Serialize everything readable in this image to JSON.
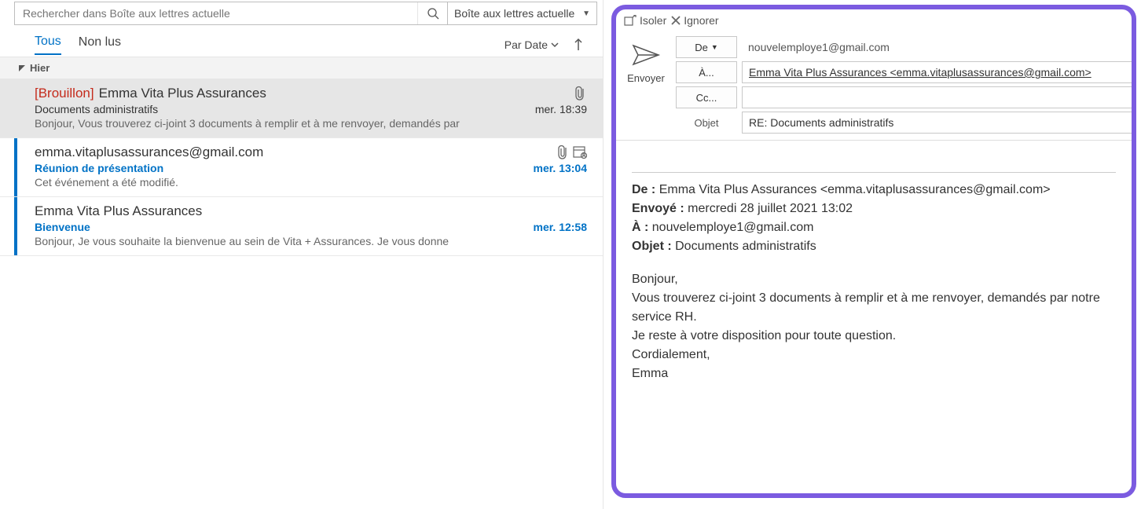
{
  "search": {
    "placeholder": "Rechercher dans Boîte aux lettres actuelle",
    "scope": "Boîte aux lettres actuelle"
  },
  "filters": {
    "all": "Tous",
    "unread": "Non lus",
    "sort_label": "Par Date"
  },
  "group_header": "Hier",
  "messages": [
    {
      "draft_label": "[Brouillon]",
      "sender": "Emma Vita Plus Assurances",
      "subject": "Documents administratifs",
      "time": "mer. 18:39",
      "preview": "Bonjour,  Vous trouverez ci-joint 3 documents à remplir et à me renvoyer, demandés par"
    },
    {
      "sender": "emma.vitaplusassurances@gmail.com",
      "subject": "Réunion de présentation",
      "time": "mer. 13:04",
      "preview": "Cet événement a été modifié."
    },
    {
      "sender": "Emma Vita Plus Assurances",
      "subject": "Bienvenue",
      "time": "mer. 12:58",
      "preview": "Bonjour,   Je vous souhaite la bienvenue au sein de Vita + Assurances.   Je vous donne"
    }
  ],
  "compose_toolbar": {
    "isolate": "Isoler",
    "ignore": "Ignorer"
  },
  "compose": {
    "send_label": "Envoyer",
    "from_label": "De",
    "from_value": "nouvelemploye1@gmail.com",
    "to_label": "À...",
    "to_value": "Emma Vita Plus Assurances <emma.vitaplusassurances@gmail.com>",
    "cc_label": "Cc...",
    "cc_value": "",
    "subject_label": "Objet",
    "subject_value": "RE: Documents administratifs"
  },
  "quoted": {
    "from_label": "De :",
    "from_value": "Emma Vita Plus Assurances <emma.vitaplusassurances@gmail.com>",
    "sent_label": "Envoyé :",
    "sent_value": "mercredi 28 juillet 2021 13:02",
    "to_label": "À :",
    "to_value": "nouvelemploye1@gmail.com",
    "subject_label": "Objet :",
    "subject_value": "Documents administratifs",
    "body_lines": [
      "Bonjour,",
      "Vous trouverez ci-joint 3 documents à remplir et à me renvoyer, demandés par notre service RH.",
      "Je reste à votre disposition pour toute question.",
      "Cordialement,",
      "Emma"
    ]
  }
}
